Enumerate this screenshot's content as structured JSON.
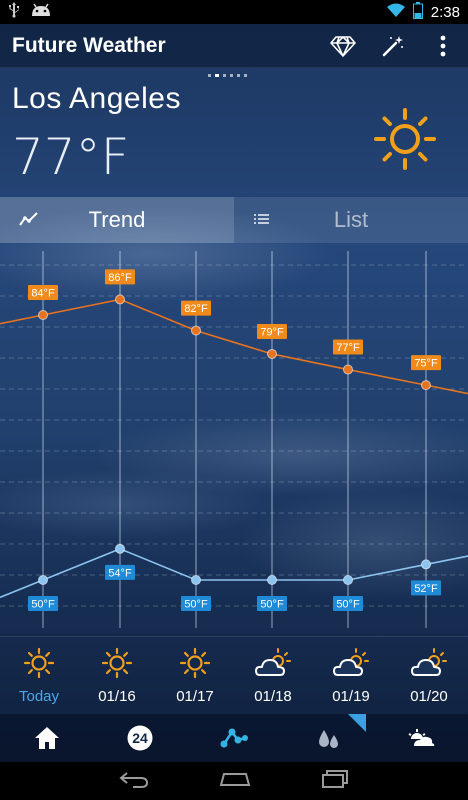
{
  "status_bar": {
    "time": "2:38",
    "icons": [
      "usb-icon",
      "android-icon",
      "wifi-icon",
      "battery-icon"
    ]
  },
  "app": {
    "title": "Future Weather",
    "actions": [
      "diamond-icon",
      "magic-wand-icon",
      "overflow-menu-icon"
    ]
  },
  "current": {
    "city": "Los Angeles",
    "temperature": "77°F",
    "condition_icon": "sun-icon"
  },
  "tabs": [
    {
      "label": "Trend",
      "icon": "trend-chart-icon",
      "active": true
    },
    {
      "label": "List",
      "icon": "list-icon",
      "active": false
    }
  ],
  "colors": {
    "high_line": "#e5731f",
    "low_line": "#8cc4f0",
    "high_label_bg": "#f08a1a",
    "low_label_bg": "#1f8ad6",
    "today_label": "#4aa8e8",
    "sun": "#f2a01c"
  },
  "chart_data": {
    "type": "line",
    "categories": [
      "Today",
      "01/16",
      "01/17",
      "01/18",
      "01/19",
      "01/20"
    ],
    "series": [
      {
        "values": [
          84,
          86,
          82,
          79,
          77,
          75
        ],
        "labels": [
          "84°F",
          "86°F",
          "82°F",
          "79°F",
          "77°F",
          "75°F"
        ]
      },
      {
        "values": [
          50,
          54,
          50,
          50,
          50,
          52
        ],
        "labels": [
          "50°F",
          "54°F",
          "50°F",
          "50°F",
          "50°F",
          "52°F"
        ]
      }
    ]
  },
  "forecast": [
    {
      "label": "Today",
      "icon": "sun-icon"
    },
    {
      "label": "01/16",
      "icon": "sun-icon"
    },
    {
      "label": "01/17",
      "icon": "sun-icon"
    },
    {
      "label": "01/18",
      "icon": "partly-cloudy-icon"
    },
    {
      "label": "01/19",
      "icon": "partly-cloudy-icon"
    },
    {
      "label": "01/20",
      "icon": "partly-cloudy-icon"
    }
  ],
  "bottom_nav": [
    {
      "icon": "home-icon"
    },
    {
      "icon": "24-hour-icon",
      "text": "24"
    },
    {
      "icon": "trend-nodes-icon",
      "active": true
    },
    {
      "icon": "precipitation-icon"
    },
    {
      "icon": "sunrise-icon"
    }
  ],
  "system_nav": [
    "back-icon",
    "home-nav-icon",
    "recents-icon"
  ]
}
